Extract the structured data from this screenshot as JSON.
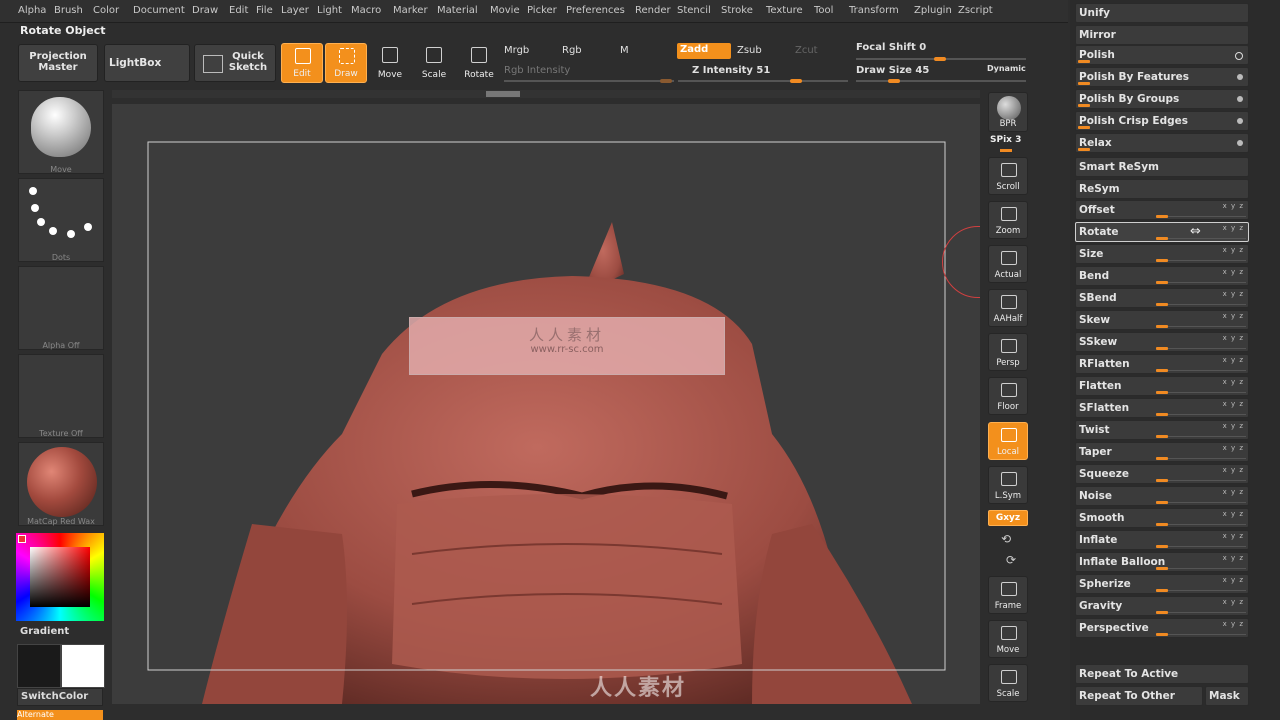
{
  "menu": [
    "Alpha",
    "Brush",
    "Color",
    "Document",
    "Draw",
    "Edit",
    "File",
    "Layer",
    "Light",
    "Macro",
    "Marker",
    "Material",
    "Movie",
    "Picker",
    "Preferences",
    "Render",
    "Stencil",
    "Stroke",
    "Texture",
    "Tool",
    "Transform",
    "Zplugin",
    "Zscript"
  ],
  "title": "Rotate Object",
  "watermark_url": "www.rr-sc.com",
  "toolbar": {
    "projection_master": "Projection Master",
    "lightbox": "LightBox",
    "quick_sketch": "Quick Sketch",
    "edit": "Edit",
    "draw": "Draw",
    "move": "Move",
    "scale": "Scale",
    "rotate": "Rotate",
    "mrgb": "Mrgb",
    "rgb": "Rgb",
    "m": "M",
    "zadd": "Zadd",
    "zsub": "Zsub",
    "zcut": "Zcut",
    "rgb_intensity": "Rgb Intensity",
    "z_intensity": "Z Intensity 51",
    "focal_shift": "Focal Shift 0",
    "draw_size": "Draw Size 45",
    "dynamic": "Dynamic"
  },
  "left": {
    "brush_label": "Move",
    "stroke_label": "Dots",
    "alpha_label": "Alpha Off",
    "texture_label": "Texture Off",
    "material_label": "MatCap Red Wax",
    "gradient_label": "Gradient",
    "switch_color": "SwitchColor",
    "alternate": "Alternate"
  },
  "overlay_watermark": "人人素材",
  "bottom_watermark": "人人素材",
  "shelf": {
    "bpr": "BPR",
    "spix": "SPix 3",
    "scroll": "Scroll",
    "zoom": "Zoom",
    "actual": "Actual",
    "aahalf": "AAHalf",
    "persp": "Persp",
    "floor": "Floor",
    "local": "Local",
    "lsym": "L.Sym",
    "xyz": "Gxyz",
    "frame": "Frame",
    "move": "Move",
    "scale": "Scale"
  },
  "deformation": {
    "unify": "Unify",
    "mirror": "Mirror",
    "rows": [
      "Polish",
      "Polish By Features",
      "Polish By Groups",
      "Polish Crisp Edges",
      "Relax"
    ],
    "smart_resym": "Smart ReSym",
    "resym": "ReSym",
    "sliders": [
      "Offset",
      "Rotate",
      "Size",
      "Bend",
      "SBend",
      "Skew",
      "SSkew",
      "RFlatten",
      "Flatten",
      "SFlatten",
      "Twist",
      "Taper",
      "Squeeze",
      "Noise",
      "Smooth",
      "Inflate",
      "Inflate Balloon",
      "Spherize",
      "Gravity",
      "Perspective"
    ],
    "axis_tag": "x y z",
    "repeat_active": "Repeat To Active",
    "repeat_other": "Repeat To Other",
    "mask": "Mask"
  },
  "colors": {
    "accent": "#f3901c",
    "clay": "#a5524a",
    "panel": "#3b3b3b"
  }
}
